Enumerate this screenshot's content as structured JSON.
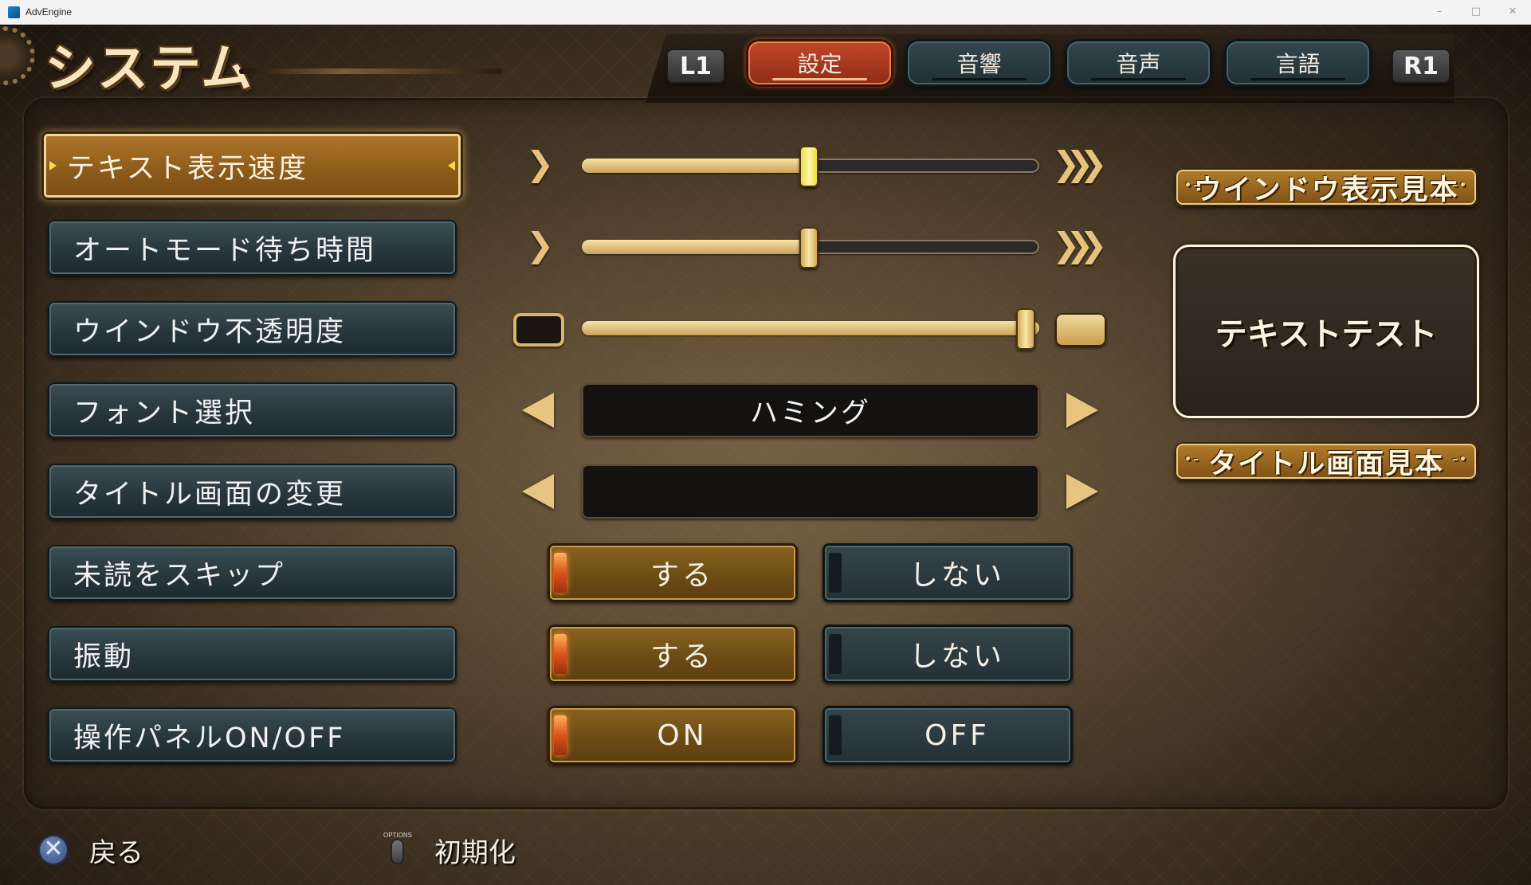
{
  "window": {
    "title": "AdvEngine"
  },
  "header": {
    "title": "システム"
  },
  "tabs": {
    "left_bumper": "L1",
    "right_bumper": "R1",
    "items": [
      {
        "label": "設定",
        "active": true
      },
      {
        "label": "音響",
        "active": false
      },
      {
        "label": "音声",
        "active": false
      },
      {
        "label": "言語",
        "active": false
      }
    ]
  },
  "settings": [
    {
      "label": "テキスト表示速度",
      "selected": true,
      "control": "slider",
      "value_fraction": 0.5
    },
    {
      "label": "オートモード待ち時間",
      "selected": false,
      "control": "slider",
      "value_fraction": 0.5
    },
    {
      "label": "ウインドウ不透明度",
      "selected": false,
      "control": "slider",
      "value_fraction": 1.0
    },
    {
      "label": "フォント選択",
      "selected": false,
      "control": "selector",
      "value": "ハミング"
    },
    {
      "label": "タイトル画面の変更",
      "selected": false,
      "control": "selector",
      "value": ""
    },
    {
      "label": "未読をスキップ",
      "selected": false,
      "control": "toggle",
      "options": [
        "する",
        "しない"
      ],
      "current": "する"
    },
    {
      "label": "振動",
      "selected": false,
      "control": "toggle",
      "options": [
        "する",
        "しない"
      ],
      "current": "する"
    },
    {
      "label": "操作パネルON/OFF",
      "selected": false,
      "control": "toggle",
      "options": [
        "ON",
        "OFF"
      ],
      "current": "ON"
    }
  ],
  "preview": {
    "window_sample_title": "ウインドウ表示見本",
    "window_sample_text": "テキストテスト",
    "title_sample_title": "タイトル画面見本"
  },
  "footer": {
    "back_label": "戻る",
    "options_caption": "OPTIONS",
    "reset_label": "初期化"
  },
  "colors": {
    "accent_gold": "#c9a25a",
    "active_tab": "#b23c20",
    "button_teal": "#2c3e43",
    "on_state": "#7a5618"
  }
}
